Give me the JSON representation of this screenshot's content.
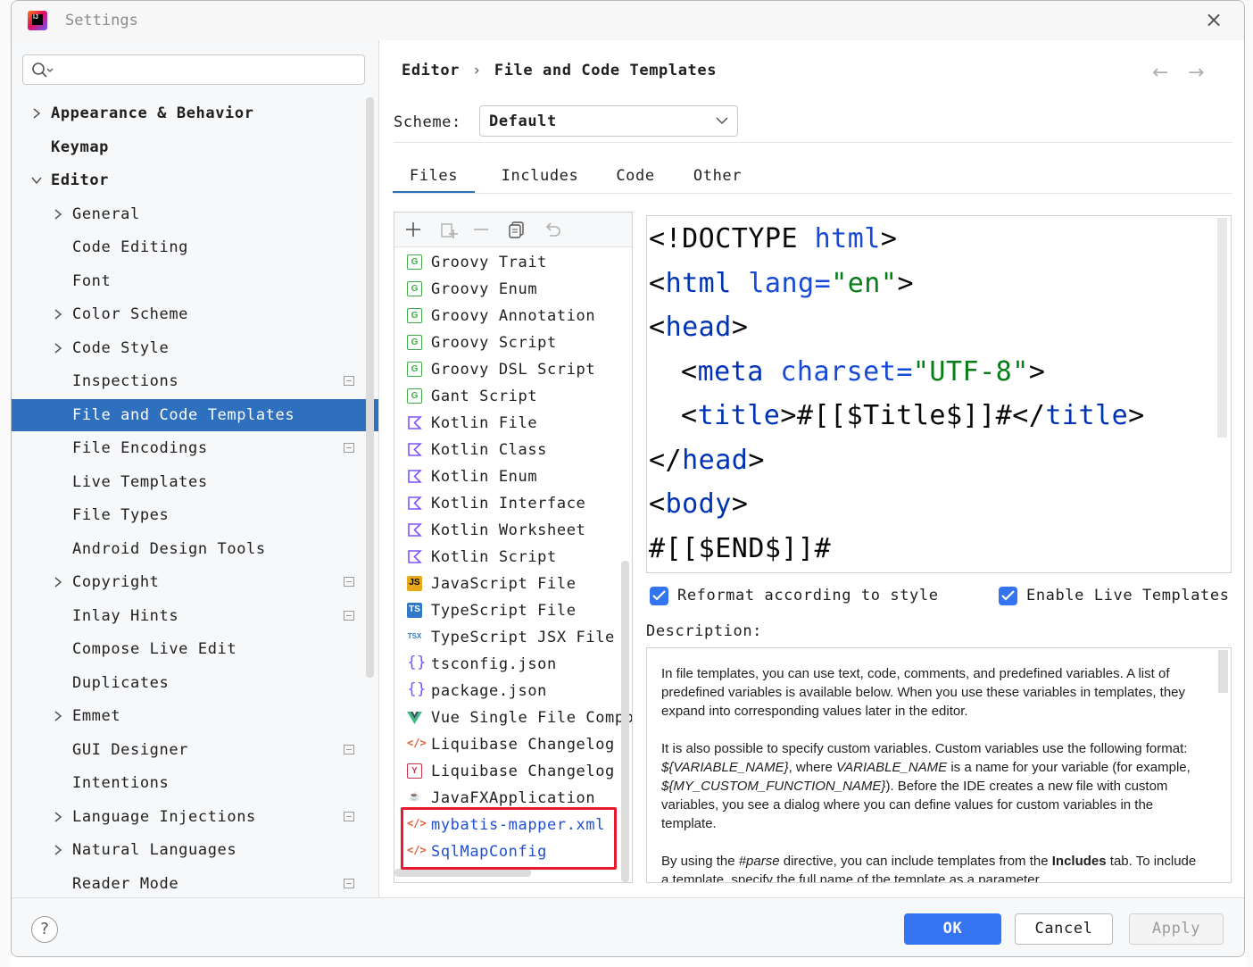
{
  "window": {
    "title": "Settings"
  },
  "search": {
    "placeholder": ""
  },
  "tree": [
    {
      "label": "Appearance & Behavior",
      "level": 0,
      "arrow": "right",
      "bold": true
    },
    {
      "label": "Keymap",
      "level": 0,
      "arrow": "none",
      "bold": true
    },
    {
      "label": "Editor",
      "level": 0,
      "arrow": "down",
      "bold": true
    },
    {
      "label": "General",
      "level": 1,
      "arrow": "right"
    },
    {
      "label": "Code Editing",
      "level": 1,
      "arrow": "none"
    },
    {
      "label": "Font",
      "level": 1,
      "arrow": "none"
    },
    {
      "label": "Color Scheme",
      "level": 1,
      "arrow": "right"
    },
    {
      "label": "Code Style",
      "level": 1,
      "arrow": "right"
    },
    {
      "label": "Inspections",
      "level": 1,
      "arrow": "none",
      "project": true
    },
    {
      "label": "File and Code Templates",
      "level": 1,
      "arrow": "none",
      "selected": true
    },
    {
      "label": "File Encodings",
      "level": 1,
      "arrow": "none",
      "project": true
    },
    {
      "label": "Live Templates",
      "level": 1,
      "arrow": "none"
    },
    {
      "label": "File Types",
      "level": 1,
      "arrow": "none"
    },
    {
      "label": "Android Design Tools",
      "level": 1,
      "arrow": "none"
    },
    {
      "label": "Copyright",
      "level": 1,
      "arrow": "right",
      "project": true
    },
    {
      "label": "Inlay Hints",
      "level": 1,
      "arrow": "none",
      "project": true
    },
    {
      "label": "Compose Live Edit",
      "level": 1,
      "arrow": "none"
    },
    {
      "label": "Duplicates",
      "level": 1,
      "arrow": "none"
    },
    {
      "label": "Emmet",
      "level": 1,
      "arrow": "right"
    },
    {
      "label": "GUI Designer",
      "level": 1,
      "arrow": "none",
      "project": true
    },
    {
      "label": "Intentions",
      "level": 1,
      "arrow": "none"
    },
    {
      "label": "Language Injections",
      "level": 1,
      "arrow": "right",
      "project": true
    },
    {
      "label": "Natural Languages",
      "level": 1,
      "arrow": "right"
    },
    {
      "label": "Reader Mode",
      "level": 1,
      "arrow": "none",
      "project": true
    }
  ],
  "breadcrumb": {
    "parent": "Editor",
    "separator": "›",
    "current": "File and Code Templates"
  },
  "nav": {
    "back": "←",
    "forward": "→"
  },
  "scheme": {
    "label": "Scheme:",
    "value": "Default"
  },
  "tabs": [
    {
      "label": "Files",
      "active": true
    },
    {
      "label": "Includes"
    },
    {
      "label": "Code"
    },
    {
      "label": "Other"
    }
  ],
  "toolbar_icons": [
    "add-icon",
    "add-child-icon",
    "remove-icon",
    "copy-icon",
    "reset-icon"
  ],
  "templates": [
    {
      "name": "Groovy Trait",
      "icon": "groovy-icon",
      "glyph": "G"
    },
    {
      "name": "Groovy Enum",
      "icon": "groovy-icon",
      "glyph": "G"
    },
    {
      "name": "Groovy Annotation",
      "icon": "groovy-icon",
      "glyph": "G"
    },
    {
      "name": "Groovy Script",
      "icon": "groovy-icon",
      "glyph": "G"
    },
    {
      "name": "Groovy DSL Script",
      "icon": "groovy-icon",
      "glyph": "G"
    },
    {
      "name": "Gant Script",
      "icon": "groovy-icon",
      "glyph": "G"
    },
    {
      "name": "Kotlin File",
      "icon": "kotlin-icon",
      "glyph": "K"
    },
    {
      "name": "Kotlin Class",
      "icon": "kotlin-icon",
      "glyph": "K"
    },
    {
      "name": "Kotlin Enum",
      "icon": "kotlin-icon",
      "glyph": "K"
    },
    {
      "name": "Kotlin Interface",
      "icon": "kotlin-icon",
      "glyph": "K"
    },
    {
      "name": "Kotlin Worksheet",
      "icon": "kotlin-icon",
      "glyph": "K"
    },
    {
      "name": "Kotlin Script",
      "icon": "kotlin-icon",
      "glyph": "K"
    },
    {
      "name": "JavaScript File",
      "icon": "javascript-icon",
      "glyph": "JS"
    },
    {
      "name": "TypeScript File",
      "icon": "typescript-icon",
      "glyph": "TS"
    },
    {
      "name": "TypeScript JSX File",
      "icon": "tsx-icon",
      "glyph": "TSX"
    },
    {
      "name": "tsconfig.json",
      "icon": "json-icon",
      "glyph": "{}"
    },
    {
      "name": "package.json",
      "icon": "json-icon",
      "glyph": "{}"
    },
    {
      "name": "Vue Single File Compo",
      "icon": "vue-icon",
      "glyph": "V"
    },
    {
      "name": "Liquibase Changelog",
      "icon": "xml-icon",
      "glyph": "</>"
    },
    {
      "name": "Liquibase Changelog",
      "icon": "yaml-icon",
      "glyph": "Y"
    },
    {
      "name": "JavaFXApplication",
      "icon": "javafx-icon",
      "glyph": "☕"
    },
    {
      "name": "mybatis-mapper.xml",
      "icon": "xml-icon",
      "glyph": "</>",
      "custom": true
    },
    {
      "name": "SqlMapConfig",
      "icon": "xml-icon",
      "glyph": "</>",
      "custom": true
    }
  ],
  "code_lines": [
    {
      "indent": 0,
      "tokens": [
        {
          "t": "<!DOCTYPE ",
          "c": "txt"
        },
        {
          "t": "html",
          "c": "attr"
        },
        {
          "t": ">",
          "c": "txt"
        }
      ]
    },
    {
      "indent": 0,
      "tokens": [
        {
          "t": "<",
          "c": "txt"
        },
        {
          "t": "html",
          "c": "tag"
        },
        {
          "t": " ",
          "c": "txt"
        },
        {
          "t": "lang",
          "c": "attr"
        },
        {
          "t": "=",
          "c": "attr"
        },
        {
          "t": "\"en\"",
          "c": "str"
        },
        {
          "t": ">",
          "c": "txt"
        }
      ]
    },
    {
      "indent": 0,
      "tokens": [
        {
          "t": "<",
          "c": "txt"
        },
        {
          "t": "head",
          "c": "tag"
        },
        {
          "t": ">",
          "c": "txt"
        }
      ]
    },
    {
      "indent": 1,
      "tokens": [
        {
          "t": "<",
          "c": "txt"
        },
        {
          "t": "meta",
          "c": "tag"
        },
        {
          "t": " ",
          "c": "txt"
        },
        {
          "t": "charset",
          "c": "attr"
        },
        {
          "t": "=",
          "c": "attr"
        },
        {
          "t": "\"UTF-8\"",
          "c": "str"
        },
        {
          "t": ">",
          "c": "txt"
        }
      ]
    },
    {
      "indent": 1,
      "tokens": [
        {
          "t": "<",
          "c": "txt"
        },
        {
          "t": "title",
          "c": "tag"
        },
        {
          "t": ">#[[$Title$]]#</",
          "c": "txt"
        },
        {
          "t": "title",
          "c": "tag"
        },
        {
          "t": ">",
          "c": "txt"
        }
      ]
    },
    {
      "indent": 0,
      "tokens": [
        {
          "t": "</",
          "c": "txt"
        },
        {
          "t": "head",
          "c": "tag"
        },
        {
          "t": ">",
          "c": "txt"
        }
      ]
    },
    {
      "indent": 0,
      "tokens": [
        {
          "t": "<",
          "c": "txt"
        },
        {
          "t": "body",
          "c": "tag"
        },
        {
          "t": ">",
          "c": "txt"
        }
      ]
    },
    {
      "indent": 0,
      "tokens": [
        {
          "t": "#[[$END$]]#",
          "c": "txt"
        }
      ]
    }
  ],
  "options": {
    "reformat": {
      "label": "Reformat according to style",
      "checked": true
    },
    "live_templates": {
      "label": "Enable Live Templates",
      "checked": true
    }
  },
  "description": {
    "label": "Description:",
    "p1": "In file templates, you can use text, code, comments, and predefined variables. A list of predefined variables is available below. When you use these variables in templates, they expand into corresponding values later in the editor.",
    "p2_a": "It is also possible to specify custom variables. Custom variables use the following format: ",
    "p2_var1": "${VARIABLE_NAME}",
    "p2_b": ", where ",
    "p2_var2": "VARIABLE_NAME",
    "p2_c": " is a name for your variable (for example, ",
    "p2_var3": "${MY_CUSTOM_FUNCTION_NAME}",
    "p2_d": "). Before the IDE creates a new file with custom variables, you see a dialog where you can define values for custom variables in the template.",
    "p3_a": "By using the ",
    "p3_var": "#parse",
    "p3_b": " directive, you can include templates from the ",
    "p3_bold": "Includes",
    "p3_c": " tab. To include a template, specify the full name of the template as a parameter"
  },
  "buttons": {
    "help": "?",
    "ok": "OK",
    "cancel": "Cancel",
    "apply": "Apply"
  },
  "colors": {
    "accent": "#3574f0",
    "selection": "#2e6fbe",
    "highlight_box": "#e8192c"
  }
}
